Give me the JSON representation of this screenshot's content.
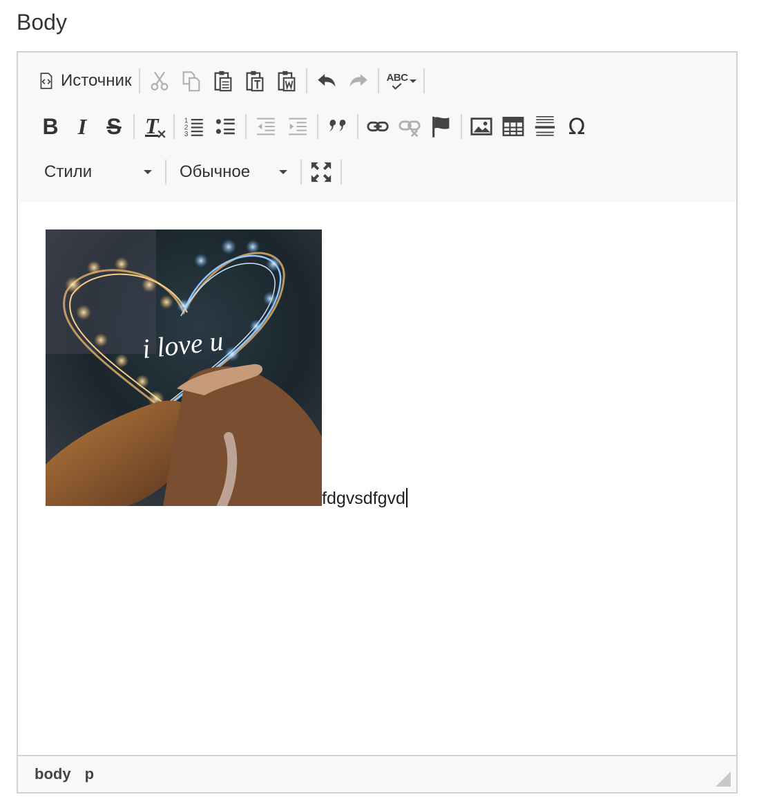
{
  "field": {
    "label": "Body"
  },
  "toolbar": {
    "source_label": "Источник",
    "styles_combo": "Стили",
    "format_combo": "Обычное",
    "row1_icons": [
      "source-icon",
      "cut-icon",
      "copy-icon",
      "paste-icon",
      "paste-text-icon",
      "paste-word-icon",
      "undo-icon",
      "redo-icon",
      "spellcheck-icon"
    ],
    "row2_icons": [
      "bold-icon",
      "italic-icon",
      "strike-icon",
      "remove-format-icon",
      "numbered-list-icon",
      "bulleted-list-icon",
      "outdent-icon",
      "indent-icon",
      "blockquote-icon",
      "link-icon",
      "unlink-icon",
      "anchor-icon",
      "image-icon",
      "table-icon",
      "horizontal-rule-icon",
      "special-char-icon"
    ],
    "row3_icons": [
      "maximize-icon"
    ],
    "spellcheck_label": "ABC",
    "bold_glyph": "B",
    "italic_glyph": "I",
    "strike_glyph": "S",
    "remove_format_glyph": "T",
    "special_char_glyph": "Ω",
    "quote_glyph": "❞"
  },
  "content": {
    "image_caption": "i love u",
    "text": "fdgvsdfgvd"
  },
  "statusbar": {
    "path": [
      "body",
      "p"
    ]
  },
  "colors": {
    "toolbar_bg": "#f8f8f8",
    "border": "#d1d1d1",
    "icon": "#444444",
    "icon_disabled": "#b0b0b0"
  }
}
